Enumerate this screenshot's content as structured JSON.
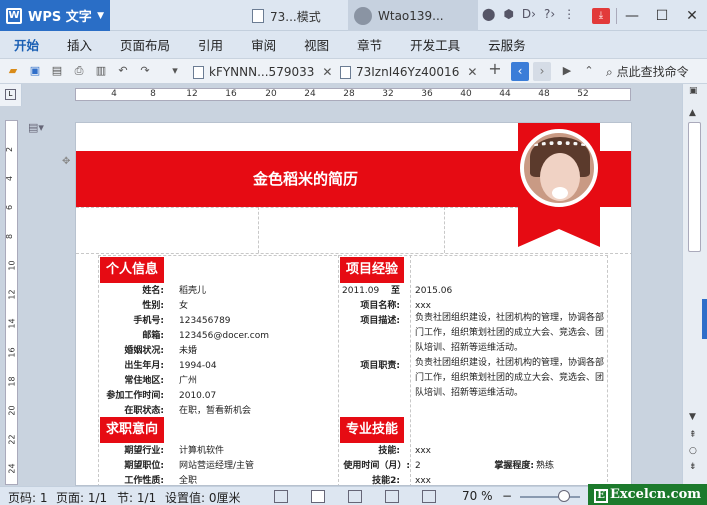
{
  "titlebar": {
    "app_name": "WPS 文字",
    "doc_tab": "73...模式",
    "user_tab": "Wtao139...",
    "close": "✕",
    "maximize": "☐",
    "minimize": "—"
  },
  "menu": [
    "开始",
    "插入",
    "页面布局",
    "引用",
    "审阅",
    "视图",
    "章节",
    "开发工具",
    "云服务"
  ],
  "toolbar": {
    "file_tab_1": "kFYNNN...579033",
    "file_tab_2": "73IznI46Yz40016",
    "search_cmd": "点此查找命令",
    "add": "+"
  },
  "ruler": {
    "h_labels": [
      "4",
      "8",
      "12",
      "16",
      "20",
      "24",
      "28",
      "32",
      "36",
      "40",
      "44",
      "48",
      "52"
    ],
    "v_labels": [
      "2",
      "4",
      "6",
      "8",
      "10",
      "12",
      "14",
      "16",
      "18",
      "20",
      "22",
      "24"
    ]
  },
  "resume": {
    "title": "金色稻米的简历",
    "sections": {
      "personal": "个人信息",
      "projects": "项目经验",
      "intent": "求职意向",
      "skills": "专业技能"
    },
    "personal": [
      {
        "label": "姓名:",
        "value": "稻壳儿"
      },
      {
        "label": "性别:",
        "value": "女"
      },
      {
        "label": "手机号:",
        "value": "123456789"
      },
      {
        "label": "邮箱:",
        "value": "123456@docer.com"
      },
      {
        "label": "婚姻状况:",
        "value": "未婚"
      },
      {
        "label": "出生年月:",
        "value": "1994-04"
      },
      {
        "label": "常住地区:",
        "value": "广州"
      },
      {
        "label": "参加工作时间:",
        "value": "2010.07"
      },
      {
        "label": "在职状态:",
        "value": "在职，暂看新机会"
      }
    ],
    "project": {
      "start": "2011.09",
      "to": "至",
      "end": "2015.06",
      "name_label": "项目名称:",
      "name_value": "xxx",
      "desc_label": "项目描述:",
      "desc_value": "负责社团组织建设，社团机构的管理，协调各部门工作，组织策划社团的成立大会、竞选会、团队培训、招新等运维活动。",
      "duty_label": "项目职责:",
      "duty_value": "负责社团组织建设，社团机构的管理，协调各部门工作，组织策划社团的成立大会、竞选会、团队培训、招新等运维活动。"
    },
    "intent": [
      {
        "label": "期望行业:",
        "value": "计算机软件"
      },
      {
        "label": "期望职位:",
        "value": "网站营运经理/主管"
      },
      {
        "label": "工作性质:",
        "value": "全职"
      }
    ],
    "skills": [
      {
        "label": "技能:",
        "value": "xxx"
      },
      {
        "label": "使用时间（月）:",
        "value": "2",
        "extra_label": "掌握程度:",
        "extra_value": "熟练"
      },
      {
        "label": "技能2:",
        "value": "xxx"
      }
    ]
  },
  "statusbar": {
    "page": "页码: 1",
    "pages": "页面: 1/1",
    "section": "节: 1/1",
    "setting": "设置值: 0厘米",
    "zoom": "70 %",
    "watermark": "Excelcn.com",
    "watermark_icon": "E"
  }
}
